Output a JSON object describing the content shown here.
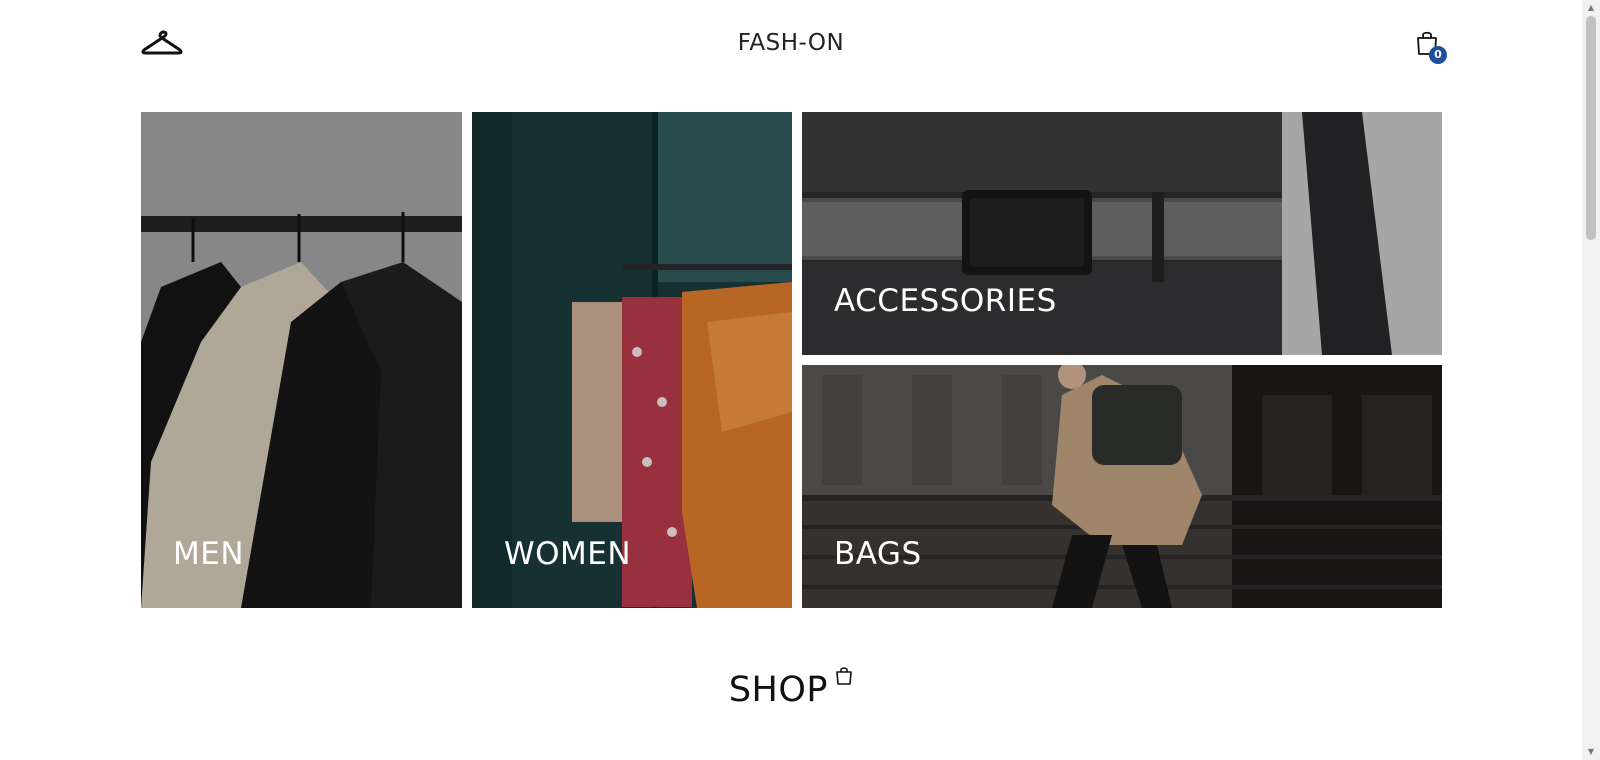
{
  "header": {
    "logo_icon": "hanger-icon",
    "brand": "FASH-ON",
    "cart_icon": "shopping-bag-icon",
    "cart_count": "0",
    "badge_color": "#1e4f9c"
  },
  "categories": [
    {
      "label": "MEN"
    },
    {
      "label": "WOMEN"
    },
    {
      "label": "ACCESSORIES"
    },
    {
      "label": "BAGS"
    }
  ],
  "shop": {
    "title": "SHOP",
    "icon": "shopping-bag-icon"
  }
}
